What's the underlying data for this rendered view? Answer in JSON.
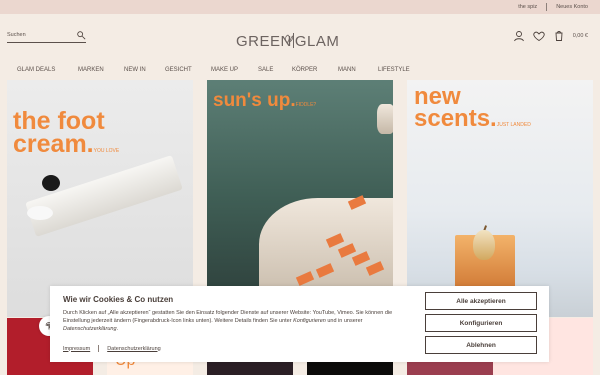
{
  "topbar": {
    "link1": "the spiz",
    "link2": "Neues Konto"
  },
  "header": {
    "search": {
      "placeholder": "Suchen"
    },
    "logo": {
      "left": "GREEN",
      "right": "GLAM"
    },
    "cart": {
      "amount": "0,00 €"
    }
  },
  "nav": {
    "items": [
      "GLAM DEALS",
      "MARKEN",
      "NEW IN",
      "GESICHT",
      "MAKE UP",
      "SALE",
      "KÖRPER",
      "MANN",
      "LIFESTYLE"
    ]
  },
  "hero": {
    "tile1": {
      "line1": "the foot",
      "line2": "cream.",
      "sub": "YOU LOVE"
    },
    "tile2": {
      "line1": "sun's up.",
      "sub": "FIDDLE?"
    },
    "tile3": {
      "line1": "new",
      "line2": "scents.",
      "sub": "JUST LANDED"
    }
  },
  "bottom": {
    "partial": "Up"
  },
  "cookies": {
    "title": "Wie wir Cookies & Co nutzen",
    "text_start": "Durch Klicken auf „Alle akzeptieren“ gestatten Sie den Einsatz folgender Dienste auf unserer Website: YouTube, Vimeo. Sie können die Einstellung jederzeit ändern (Fingerabdruck-Icon links unten). Weitere Details finden Sie unter ",
    "text_link1": "Konfigurieren",
    "text_middle": " und in unserer ",
    "text_link2": "Datenschutzerklärung",
    "text_end": ".",
    "links": {
      "impressum": "Impressum",
      "privacy": "Datenschutzerklärung"
    },
    "buttons": {
      "accept_all": "Alle akzeptieren",
      "configure": "Konfigurieren",
      "reject": "Ablehnen"
    }
  },
  "icons": {
    "search": "search-icon",
    "user": "user-icon",
    "wishlist": "heart-icon",
    "cart": "cart-icon",
    "fingerprint": "fingerprint-icon"
  },
  "colors": {
    "accent": "#f08a3d",
    "bg": "#f4ece4",
    "topbar": "#ebd7cf"
  }
}
